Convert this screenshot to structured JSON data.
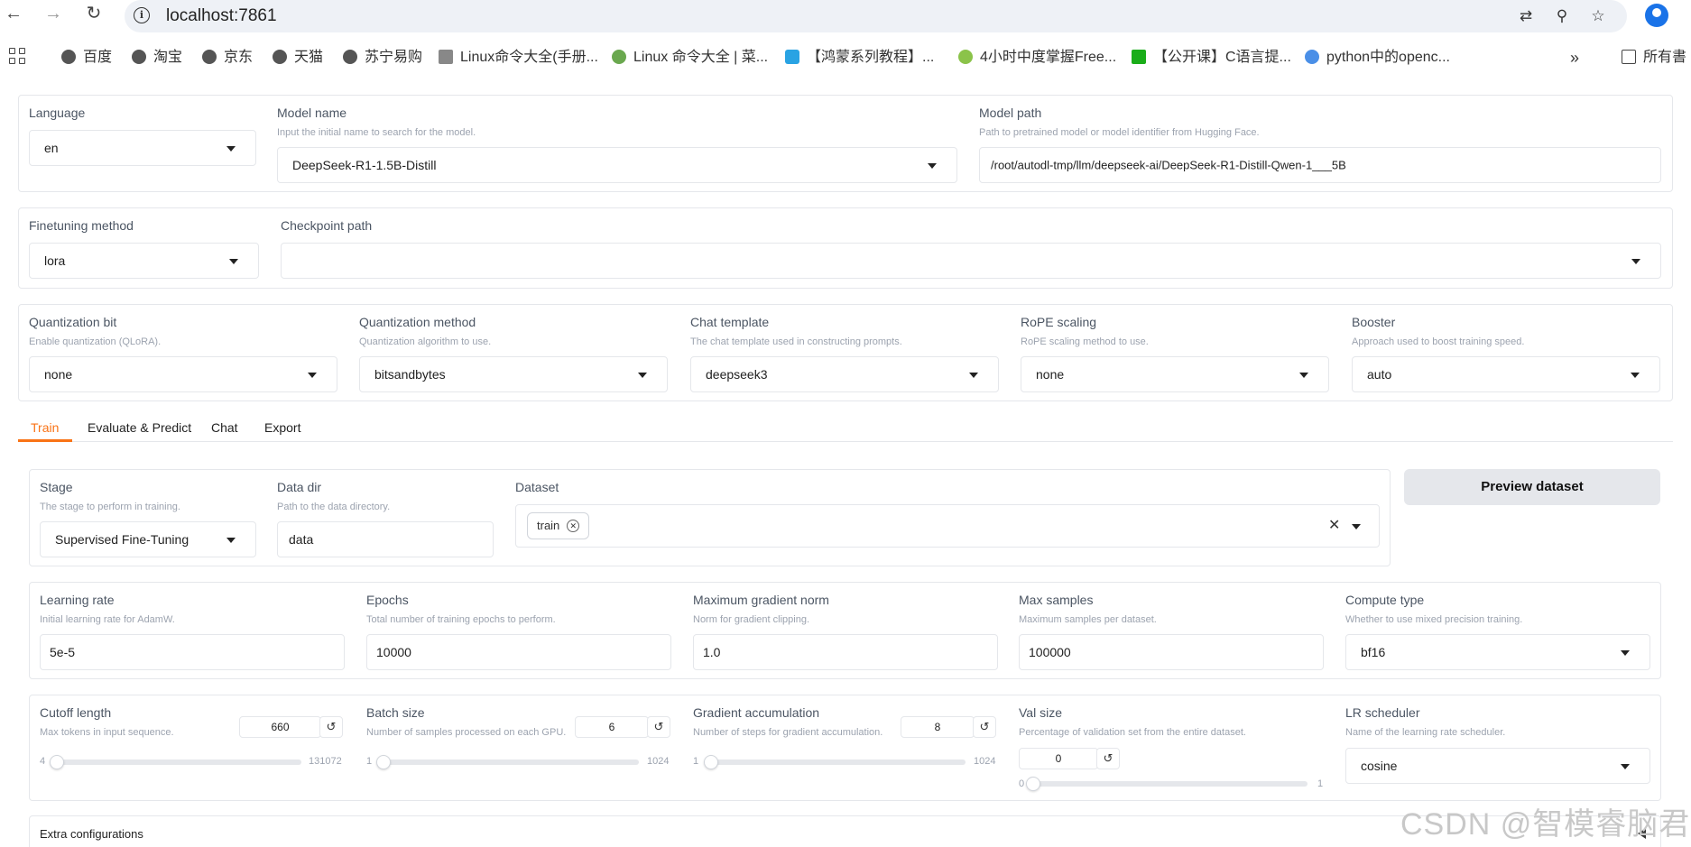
{
  "browser": {
    "url": "localhost:7861",
    "bookmarks": [
      "百度",
      "淘宝",
      "京东",
      "天猫",
      "苏宁易购",
      "Linux命令大全(手册...",
      "Linux 命令大全 | 菜...",
      "【鸿蒙系列教程】...",
      "4小时中度掌握Free...",
      "【公开课】C语言提...",
      "python中的openc...",
      "所有書"
    ]
  },
  "top": {
    "language": {
      "label": "Language",
      "value": "en"
    },
    "model_name": {
      "label": "Model name",
      "hint": "Input the initial name to search for the model.",
      "value": "DeepSeek-R1-1.5B-Distill"
    },
    "model_path": {
      "label": "Model path",
      "hint": "Path to pretrained model or model identifier from Hugging Face.",
      "value": "/root/autodl-tmp/llm/deepseek-ai/DeepSeek-R1-Distill-Qwen-1___5B"
    },
    "finetuning": {
      "label": "Finetuning method",
      "value": "lora"
    },
    "checkpoint": {
      "label": "Checkpoint path",
      "value": ""
    }
  },
  "quant": {
    "bit": {
      "label": "Quantization bit",
      "hint": "Enable quantization (QLoRA).",
      "value": "none"
    },
    "method": {
      "label": "Quantization method",
      "hint": "Quantization algorithm to use.",
      "value": "bitsandbytes"
    },
    "template": {
      "label": "Chat template",
      "hint": "The chat template used in constructing prompts.",
      "value": "deepseek3"
    },
    "rope": {
      "label": "RoPE scaling",
      "hint": "RoPE scaling method to use.",
      "value": "none"
    },
    "booster": {
      "label": "Booster",
      "hint": "Approach used to boost training speed.",
      "value": "auto"
    }
  },
  "tabs": [
    "Train",
    "Evaluate & Predict",
    "Chat",
    "Export"
  ],
  "train": {
    "stage": {
      "label": "Stage",
      "hint": "The stage to perform in training.",
      "value": "Supervised Fine-Tuning"
    },
    "data_dir": {
      "label": "Data dir",
      "hint": "Path to the data directory.",
      "value": "data"
    },
    "dataset": {
      "label": "Dataset",
      "chip": "train"
    },
    "preview_button": "Preview dataset",
    "lr": {
      "label": "Learning rate",
      "hint": "Initial learning rate for AdamW.",
      "value": "5e-5"
    },
    "epochs": {
      "label": "Epochs",
      "hint": "Total number of training epochs to perform.",
      "value": "10000"
    },
    "grad_norm": {
      "label": "Maximum gradient norm",
      "hint": "Norm for gradient clipping.",
      "value": "1.0"
    },
    "max_samples": {
      "label": "Max samples",
      "hint": "Maximum samples per dataset.",
      "value": "100000"
    },
    "compute": {
      "label": "Compute type",
      "hint": "Whether to use mixed precision training.",
      "value": "bf16"
    },
    "cutoff": {
      "label": "Cutoff length",
      "hint": "Max tokens in input sequence.",
      "value": "660",
      "min": "4",
      "max": "131072",
      "fraction": 0.005
    },
    "batch": {
      "label": "Batch size",
      "hint": "Number of samples processed on each GPU.",
      "value": "6",
      "min": "1",
      "max": "1024",
      "fraction": 0.005
    },
    "grad_acc": {
      "label": "Gradient accumulation",
      "hint": "Number of steps for gradient accumulation.",
      "value": "8",
      "min": "1",
      "max": "1024",
      "fraction": 0.007
    },
    "val": {
      "label": "Val size",
      "hint": "Percentage of validation set from the entire dataset.",
      "value": "0",
      "min": "0",
      "max": "1",
      "fraction": 0.0
    },
    "lr_sched": {
      "label": "LR scheduler",
      "hint": "Name of the learning rate scheduler.",
      "value": "cosine"
    },
    "extra": "Extra configurations"
  },
  "watermark": "CSDN @智模睿脑君"
}
